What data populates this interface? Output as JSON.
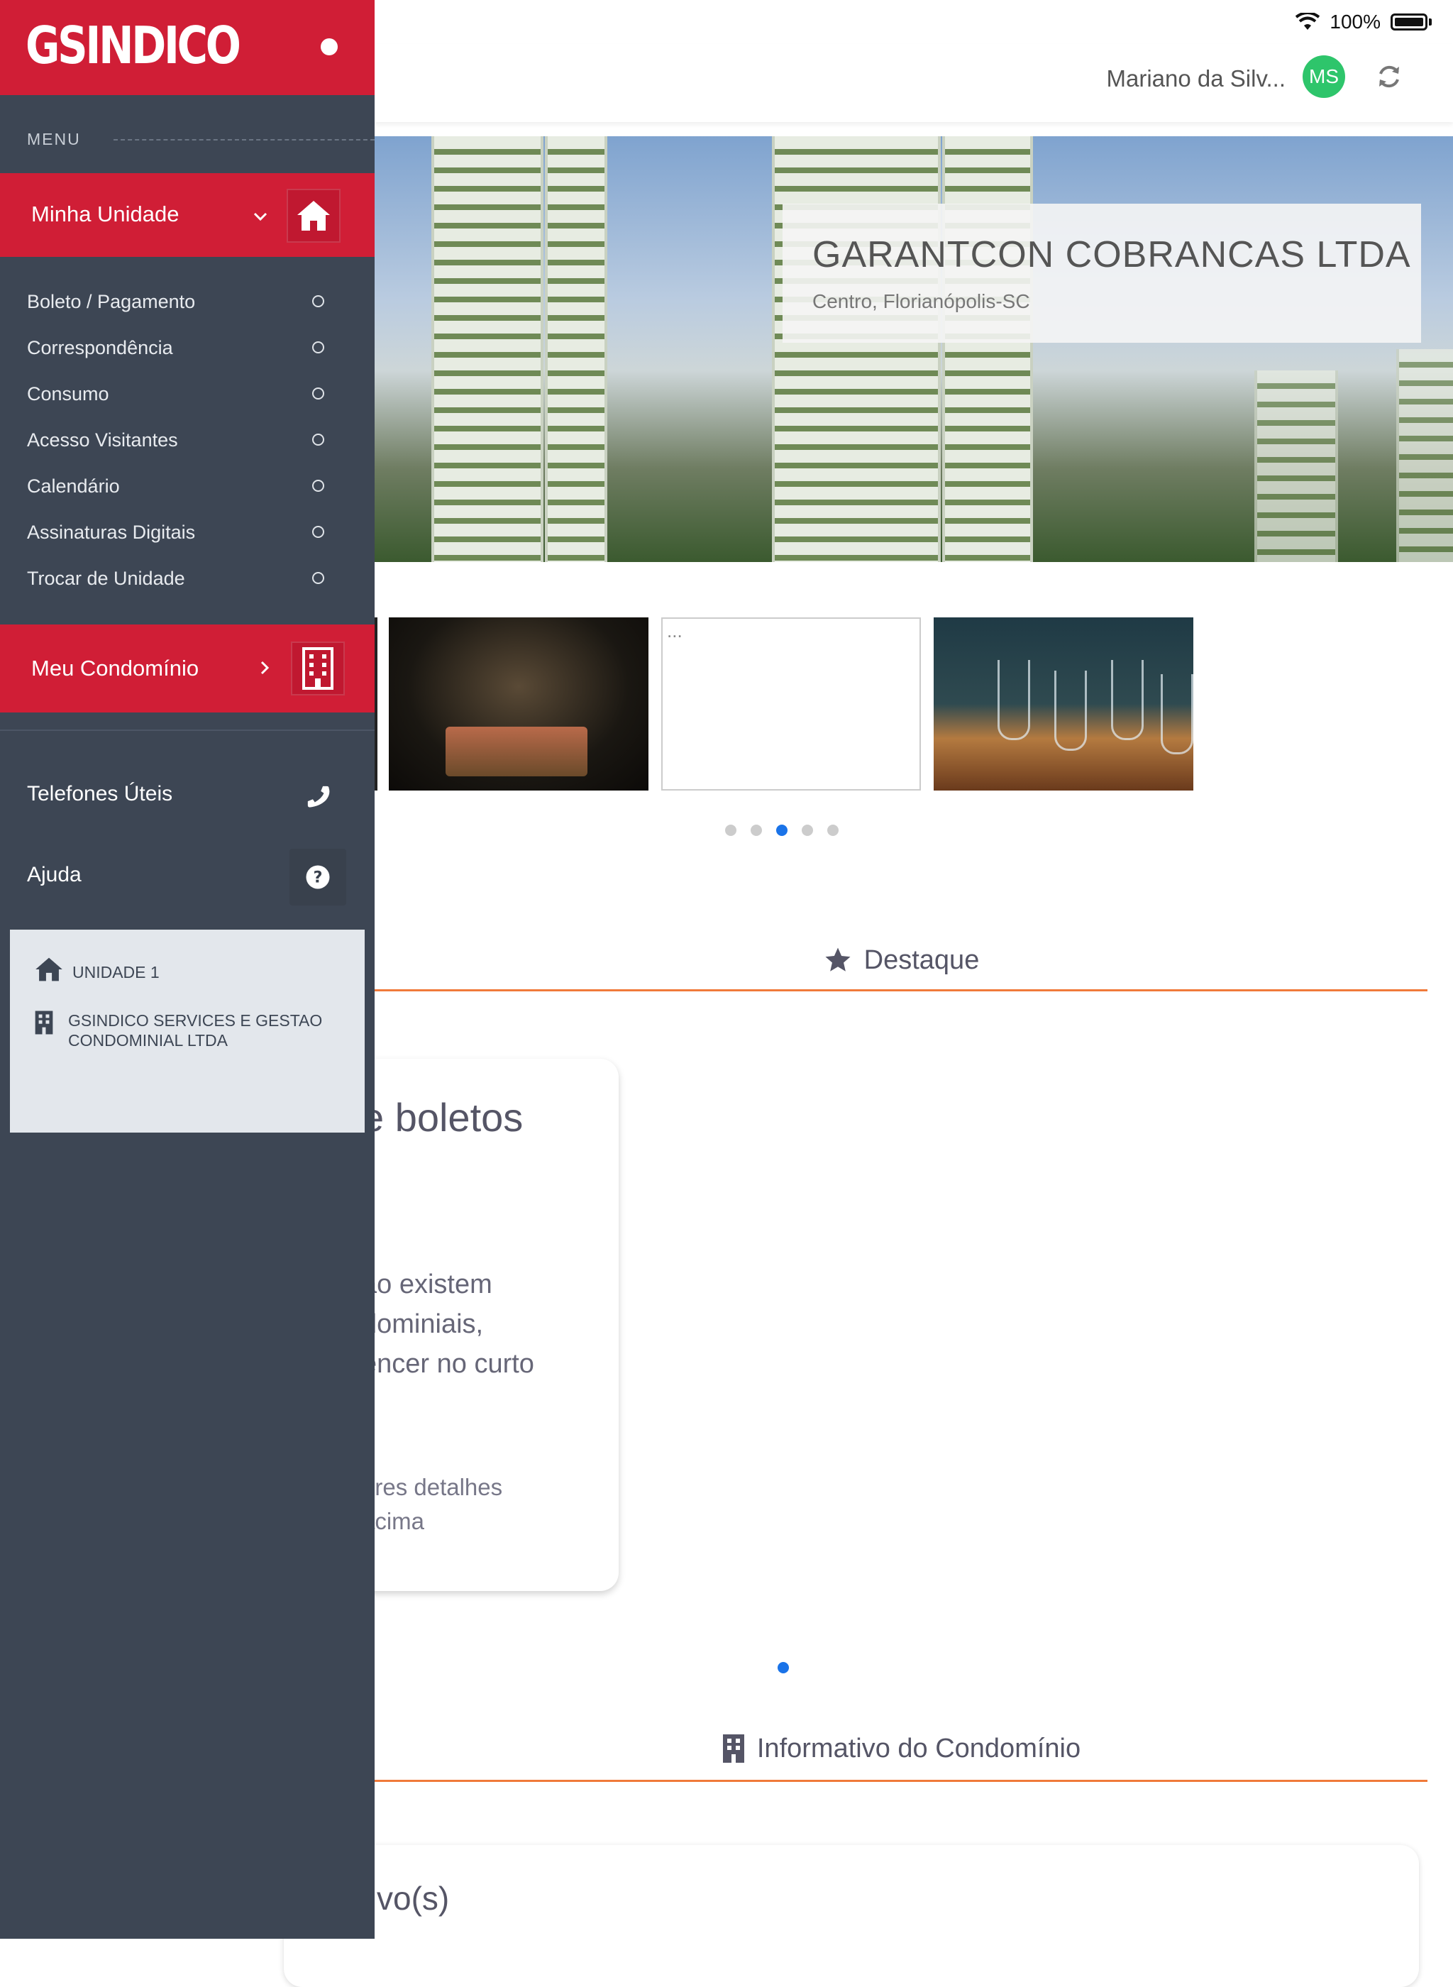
{
  "status_bar": {
    "battery": "100%"
  },
  "topbar": {
    "user_name": "Mariano da Silv...",
    "avatar_initials": "MS"
  },
  "hero": {
    "title": "GARANTCON COBRANCAS LTDA",
    "subtitle": "Centro, Florianópolis-SC"
  },
  "gallery": {
    "placeholder_text": "...",
    "page_count": 5,
    "active_index": 2
  },
  "sections": {
    "highlight": "Destaque",
    "bulletin": "Informativo do Condomínio"
  },
  "highlight_card": {
    "title": "e boletos",
    "body_lines": [
      "ão existem",
      "dominiais,",
      "encer no curto"
    ],
    "footer_lines": [
      "bres detalhes",
      "acima"
    ]
  },
  "bulletin_card": {
    "title": "tivo(s)"
  },
  "drawer": {
    "logo": "GSINDICO",
    "menu_label": "MENU",
    "my_unit": "Minha Unidade",
    "unit_items": [
      "Boleto / Pagamento",
      "Correspondência",
      "Consumo",
      "Acesso Visitantes",
      "Calendário",
      "Assinaturas Digitais",
      "Trocar de Unidade"
    ],
    "my_condo": "Meu Condomínio",
    "phones": "Telefones Úteis",
    "help": "Ajuda",
    "unit_name": "UNIDADE 1",
    "company": "GSINDICO SERVICES E GESTAO CONDOMINIAL LTDA"
  },
  "colors": {
    "brand_red": "#d01e36",
    "drawer_bg": "#3d4654",
    "accent_orange": "#f07a3a",
    "active_blue": "#1a73e8",
    "avatar_green": "#2ec56b"
  }
}
